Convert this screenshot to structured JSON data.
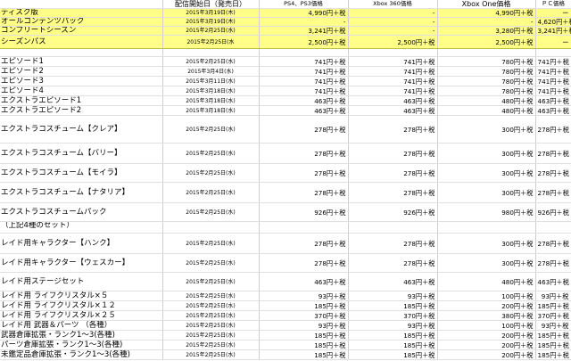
{
  "headers": [
    "",
    "配信開始日（発売日）",
    "PS4、PS3価格",
    "Xbox 360価格",
    "Xbox One価格",
    "ＰＣ価格"
  ],
  "rows": [
    {
      "name": "ディスク版",
      "date": "2015年3月19日(木)",
      "ps": "4,990円＋税",
      "x360": "-",
      "xone": "4,990円＋税",
      "pc": "ー",
      "hl": true,
      "h": 9
    },
    {
      "name": "オールコンテンツパック",
      "date": "2015年3月19日(木)",
      "ps": "-",
      "x360": "-",
      "xone": "-",
      "pc": "4,620円＋税",
      "hl": true,
      "h": 9
    },
    {
      "name": "コンプリートシーズン",
      "date": "2015年2月25日(水)",
      "ps": "3,241円＋税",
      "x360": "-",
      "xone": "3,280円＋税",
      "pc": "3,241円＋税",
      "hl": true,
      "h": 9
    },
    {
      "name": "シーズンパス",
      "date": "2015年2月25日(水",
      "ps": "2,500円＋税",
      "x360": "2,500円＋税",
      "xone": "2,500円＋税",
      "pc": "ー",
      "hl": true,
      "h": 14
    },
    {
      "spacer": true,
      "h": 8
    },
    {
      "name": "エピソード1",
      "date": "2015年2月25日(水)",
      "ps": "741円＋税",
      "x360": "741円＋税",
      "xone": "780円＋税",
      "pc": "741円＋税",
      "h": 10
    },
    {
      "name": "エピソード2",
      "date": "2015年3月4日(水)",
      "ps": "741円＋税",
      "x360": "741円＋税",
      "xone": "780円＋税",
      "pc": "741円＋税",
      "h": 10
    },
    {
      "name": "エピソード3",
      "date": "2015年3月11日(水)",
      "ps": "741円＋税",
      "x360": "741円＋税",
      "xone": "780円＋税",
      "pc": "741円＋税",
      "h": 10
    },
    {
      "name": "エピソード4",
      "date": "2015年3月18日(水)",
      "ps": "741円＋税",
      "x360": "741円＋税",
      "xone": "780円＋税",
      "pc": "741円＋税",
      "h": 10
    },
    {
      "name": "エクストラエピソード1",
      "date": "2015年3月18日(水)",
      "ps": "463円＋税",
      "x360": "463円＋税",
      "xone": "480円＋税",
      "pc": "463円＋税",
      "h": 10
    },
    {
      "name": "エクストラエピソード2",
      "date": "2015年3月18日(水)",
      "ps": "463円＋税",
      "x360": "463円＋税",
      "xone": "480円＋税",
      "pc": "463円＋税",
      "h": 10
    },
    {
      "name": "エクストラコスチューム【クレア】",
      "date": "2015年2月25日(水)",
      "ps": "278円＋税",
      "x360": "278円＋税",
      "xone": "300円＋税",
      "pc": "278円＋税",
      "h": 30
    },
    {
      "name": "エクストラコスチューム【バリー】",
      "date": "2015年2月25日(水)",
      "ps": "278円＋税",
      "x360": "278円＋税",
      "xone": "300円＋税",
      "pc": "278円＋税",
      "h": 22
    },
    {
      "name": "エクストラコスチューム【モイラ】",
      "date": "2015年2月25日(水)",
      "ps": "278円＋税",
      "x360": "278円＋税",
      "xone": "300円＋税",
      "pc": "278円＋税",
      "h": 20
    },
    {
      "name": "エクストラコスチューム【ナタリア】",
      "date": "2015年2月25日(水)",
      "ps": "278円＋税",
      "x360": "278円＋税",
      "xone": "300円＋税",
      "pc": "278円＋税",
      "h": 22
    },
    {
      "name": "エクストラコスチュームパック",
      "date": "2015年2月25日(水)",
      "ps": "926円＋税",
      "x360": "926円＋税",
      "xone": "980円＋税",
      "pc": "926円＋税",
      "h": 20
    },
    {
      "name": "（上記4種のセット）",
      "date": "",
      "ps": "",
      "x360": "",
      "xone": "",
      "pc": "",
      "h": 12,
      "sub": true
    },
    {
      "name": "レイド用キャラクター【ハンク】",
      "date": "2015年2月25日(水)",
      "ps": "278円＋税",
      "x360": "278円＋税",
      "xone": "300円＋税",
      "pc": "278円＋税",
      "h": 22
    },
    {
      "name": "レイド用キャラクター【ウェスカー】",
      "date": "2015年2月25日(水)",
      "ps": "278円＋税",
      "x360": "278円＋税",
      "xone": "300円＋税",
      "pc": "278円＋税",
      "h": 20
    },
    {
      "name": "レイド用ステージセット",
      "date": "2015年2月25日(水)",
      "ps": "463円＋税",
      "x360": "463円＋税",
      "xone": "480円＋税",
      "pc": "463円＋税",
      "h": 20
    },
    {
      "name": "レイド用 ライフクリスタル×５",
      "date": "2015年2月25日(水)",
      "ps": "93円＋税",
      "x360": "93円＋税",
      "xone": "100円＋税",
      "pc": "93円＋税",
      "h": 10
    },
    {
      "name": "レイド用 ライフクリスタル×１２",
      "date": "2015年2月25日(水)",
      "ps": "185円＋税",
      "x360": "185円＋税",
      "xone": "200円＋税",
      "pc": "185円＋税",
      "h": 10
    },
    {
      "name": "レイド用 ライフクリスタル×２５",
      "date": "2015年2月25日(水)",
      "ps": "370円＋税",
      "x360": "370円＋税",
      "xone": "380円＋税",
      "pc": "370円＋税",
      "h": 10
    },
    {
      "name": "レイド用 武器＆パーツ （各種）",
      "date": "2015年2月25日(水)",
      "ps": "93円＋税",
      "x360": "93円＋税",
      "xone": "100円＋税",
      "pc": "93円＋税",
      "h": 10
    },
    {
      "name": "武器倉庫拡張・ランク1～3(各種)",
      "date": "2015年2月25日(水)",
      "ps": "185円＋税",
      "x360": "185円＋税",
      "xone": "200円＋税",
      "pc": "185円＋税",
      "h": 10
    },
    {
      "name": "パーツ倉庫拡張・ランク1～3(各種)",
      "date": "2015年2月25日(水)",
      "ps": "185円＋税",
      "x360": "185円＋税",
      "xone": "200円＋税",
      "pc": "185円＋税",
      "h": 10
    },
    {
      "name": "未鑑定品倉庫拡張・ランク1～3(各種)",
      "date": "2015年2月25日(水)",
      "ps": "185円＋税",
      "x360": "185円＋税",
      "xone": "200円＋税",
      "pc": "185円＋税",
      "h": 10
    }
  ]
}
